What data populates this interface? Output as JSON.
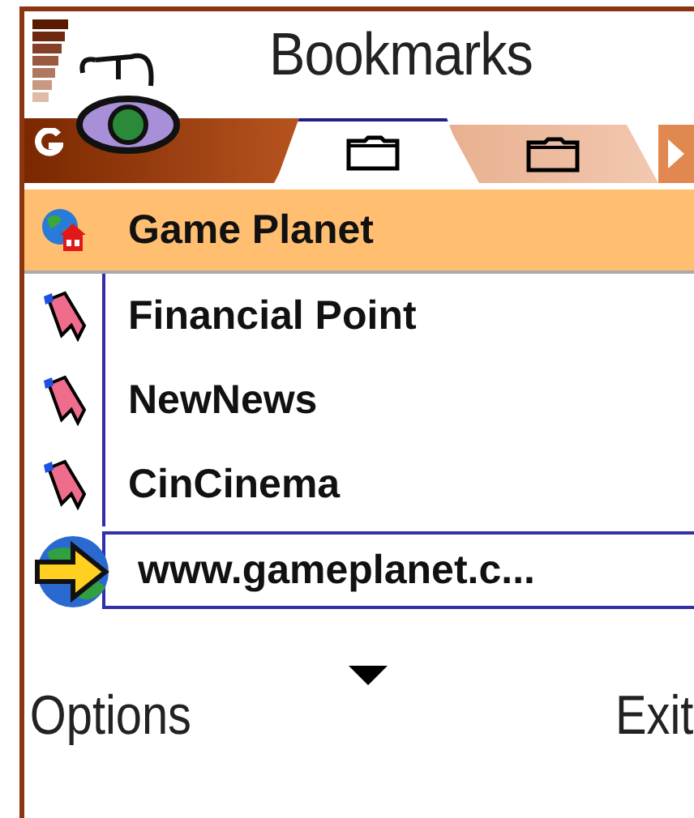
{
  "title": "Bookmarks",
  "tabs": [
    {
      "kind": "folder",
      "selected": true
    },
    {
      "kind": "folder",
      "selected": false
    }
  ],
  "items": [
    {
      "kind": "homepage",
      "label": "Game Planet",
      "selected": true
    },
    {
      "kind": "bookmark",
      "label": "Financial Point",
      "selected": false
    },
    {
      "kind": "bookmark",
      "label": "NewNews",
      "selected": false
    },
    {
      "kind": "bookmark",
      "label": "CinCinema",
      "selected": false
    }
  ],
  "address": {
    "value": "www.gameplanet.c..."
  },
  "softkeys": {
    "left": "Options",
    "right": "Exit"
  }
}
